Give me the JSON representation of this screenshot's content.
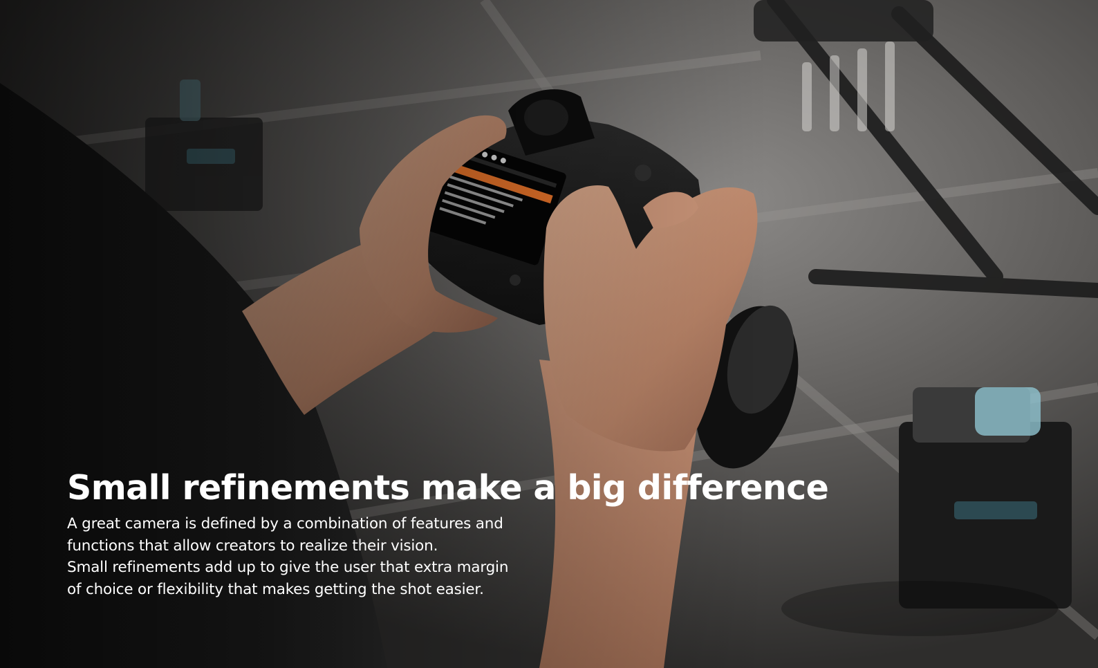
{
  "hero": {
    "headline": "Small refinements make a big difference",
    "body_lines": [
      "A great camera is defined by a combination of features and",
      "functions that allow creators to realize their vision.",
      "Small refinements add up to give the user that extra margin",
      "of choice or flexibility that makes getting the shot easier."
    ],
    "image_subject": "hands-holding-mirrorless-camera-photo",
    "colors": {
      "text": "#ffffff",
      "screen_accent": "#e8742a"
    }
  }
}
